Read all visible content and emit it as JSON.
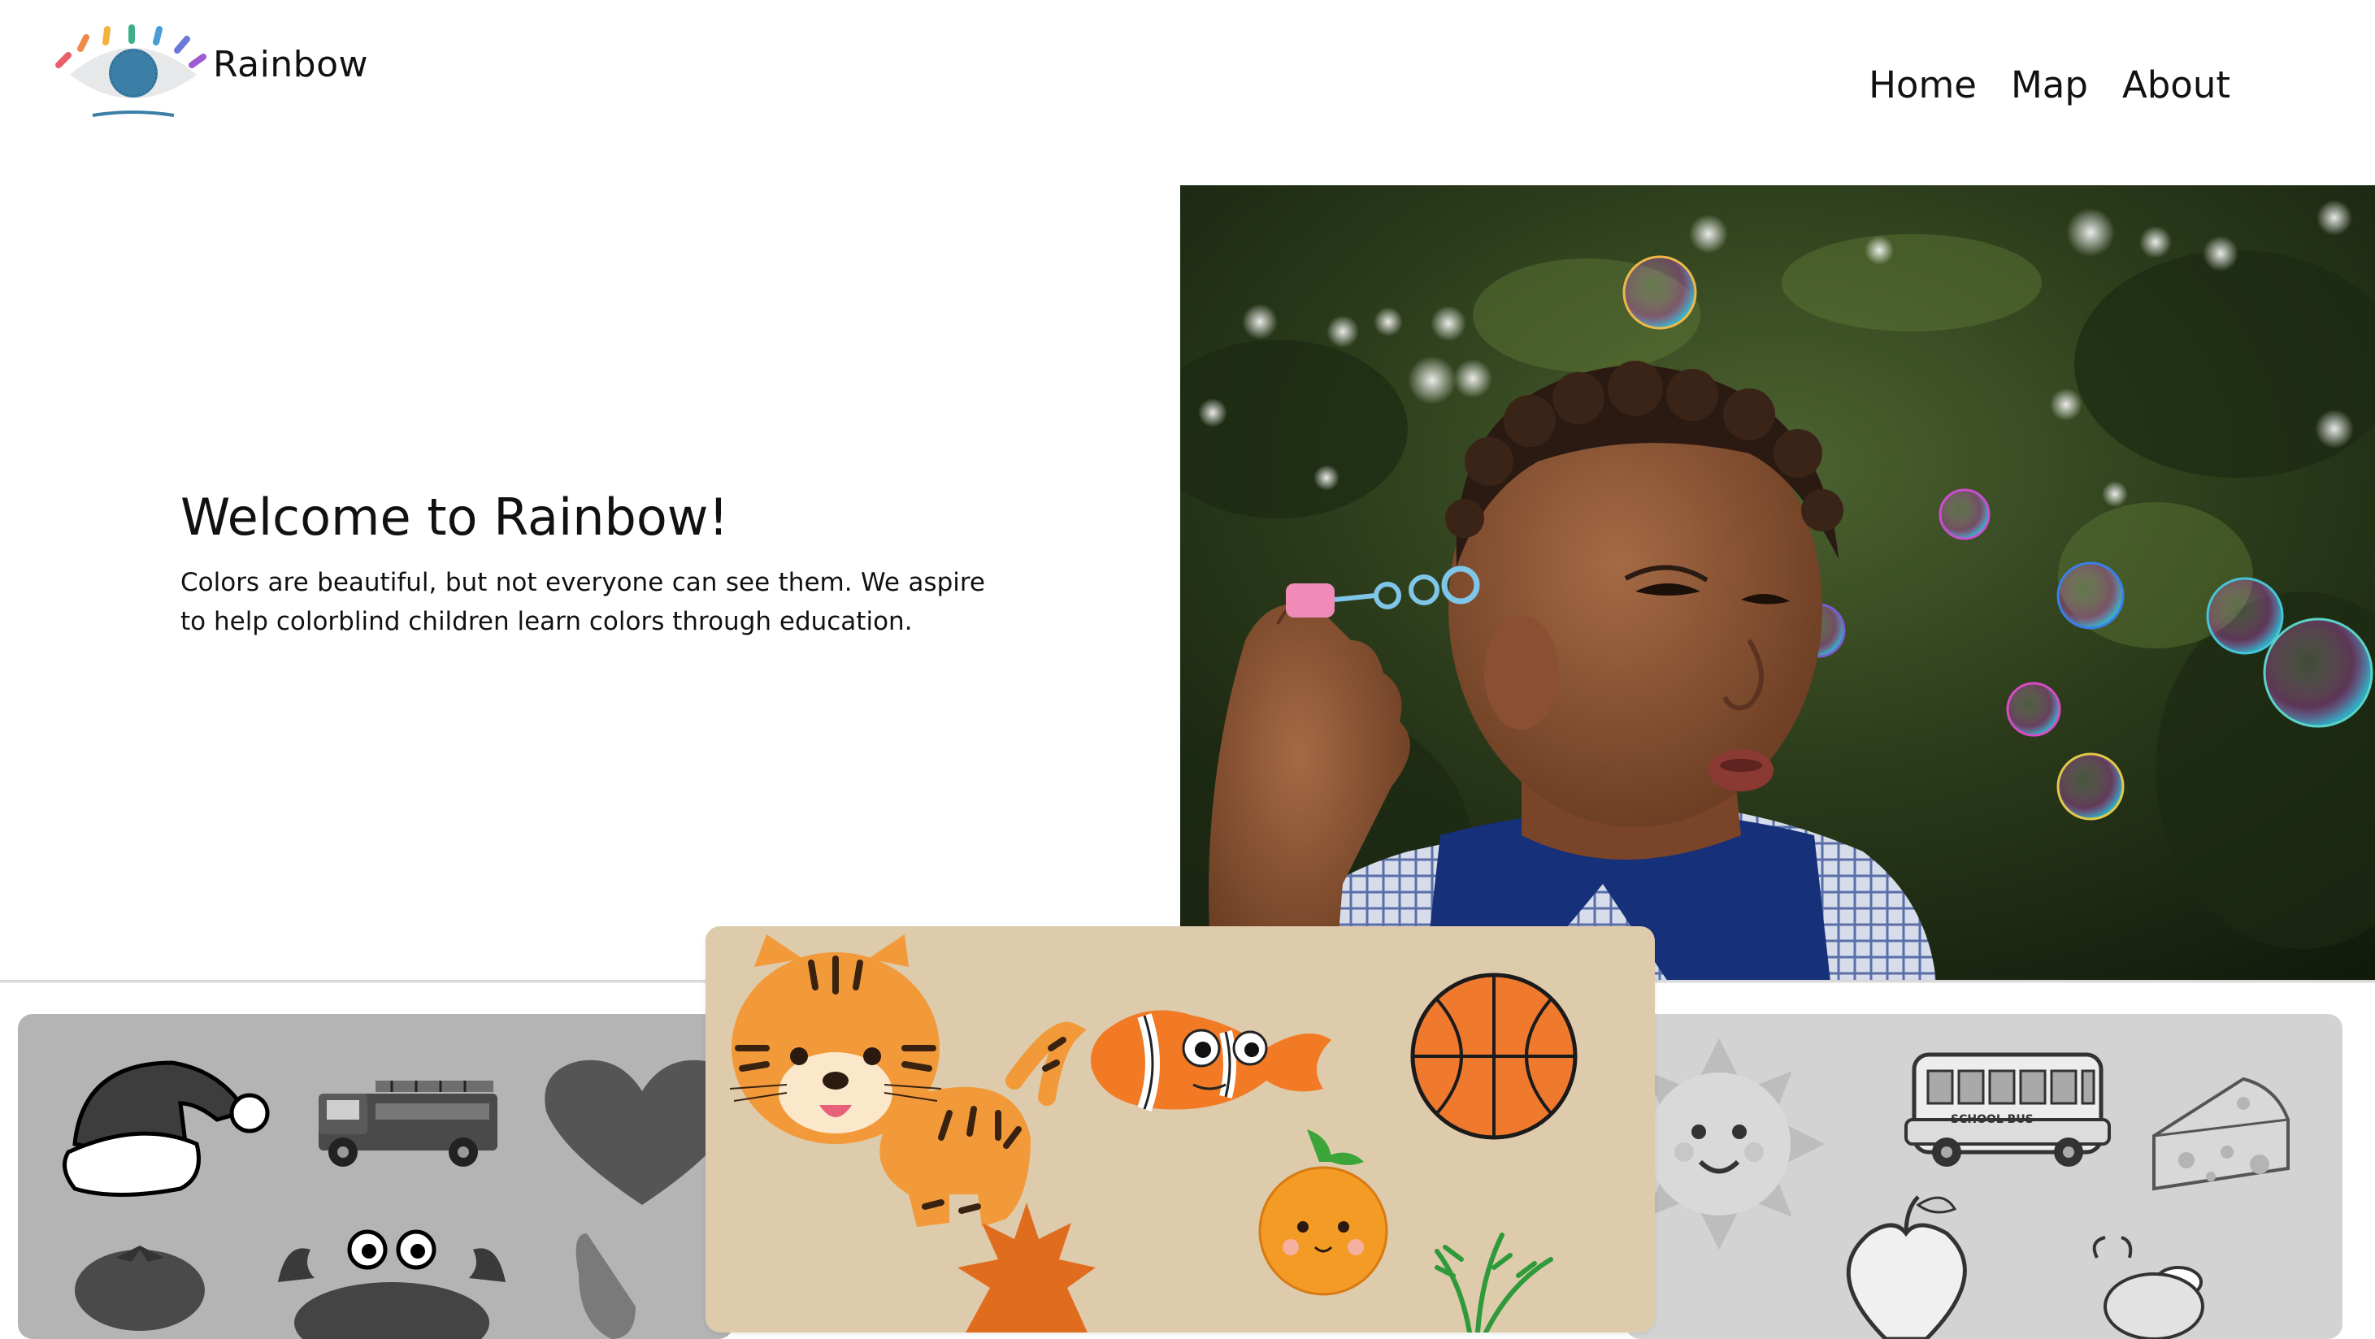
{
  "header": {
    "brand_name": "Rainbow",
    "nav": [
      {
        "label": "Home"
      },
      {
        "label": "Map"
      },
      {
        "label": "About"
      }
    ]
  },
  "hero": {
    "title": "Welcome to Rainbow!",
    "body": "Colors are beautiful, but not everyone can see them. We aspire to help colorblind children learn colors through education."
  },
  "cards": {
    "left_icons": [
      "santa-hat-icon",
      "fire-truck-icon",
      "heart-icon",
      "tomato-icon",
      "crab-icon",
      "leaf-icon"
    ],
    "center_icons": [
      "tiger-icon",
      "clownfish-icon",
      "basketball-icon",
      "orange-fruit-icon",
      "maple-leaf-icon",
      "carrot-icon"
    ],
    "right_icons": [
      "sun-icon",
      "school-bus-icon",
      "cheese-icon",
      "apple-icon",
      "bee-icon"
    ],
    "school_bus_text": "SCHOOL BUS"
  },
  "colors": {
    "center_card": "#decbac",
    "left_card": "#b4b4b4",
    "right_card": "#d3d3d3",
    "eye_iris": "#3b7fa6"
  }
}
